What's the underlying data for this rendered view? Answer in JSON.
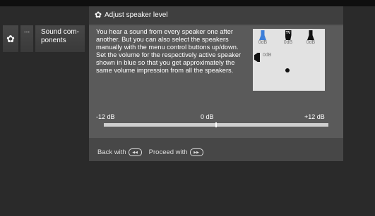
{
  "menu": {
    "more_label": "...",
    "sound_components_label": "Sound com-\nponents"
  },
  "dialog": {
    "title": "Adjust speaker level",
    "description": "You hear a sound from every speaker one after another. But you can also select the speakers manually with the menu control buttons up/down. Set the volume for the respectively active speaker shown in blue so that you get approximately the same volume impression from all the speakers.",
    "speakers": {
      "front_left_level": "0dB",
      "tv_label": "TV",
      "tv_level": "0dB",
      "front_right_level": "0dB",
      "side_left_level": "0dB"
    },
    "slider": {
      "min_label": "-12 dB",
      "mid_label": "0 dB",
      "max_label": "+12 dB",
      "value_fraction": 0.5
    },
    "footer": {
      "back_label": "Back with",
      "proceed_label": "Proceed with"
    }
  },
  "colors": {
    "active_speaker": "#3d7fd8",
    "inactive_speaker": "#111111"
  }
}
